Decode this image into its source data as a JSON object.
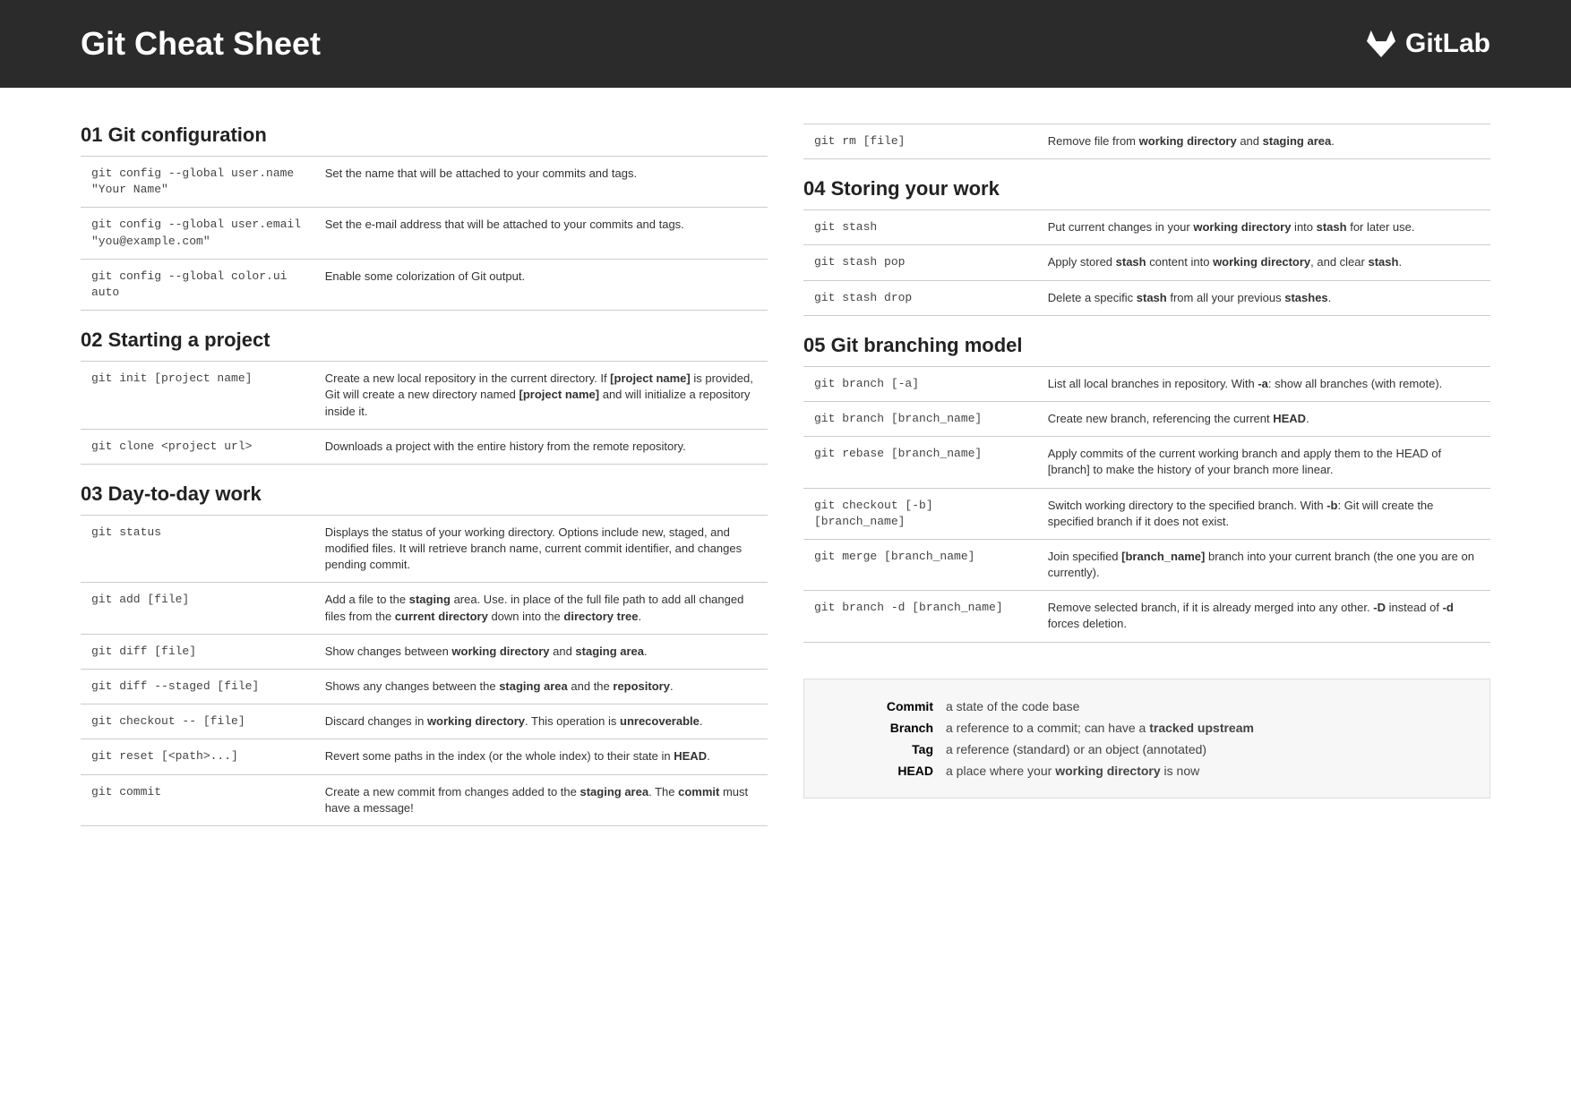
{
  "header": {
    "title": "Git Cheat Sheet",
    "brand": "GitLab"
  },
  "sections": {
    "s01": {
      "title": "01  Git configuration",
      "rows": [
        {
          "cmd": "git config --global user.name \"Your Name\"",
          "desc": "Set the name that will be attached to your commits and tags."
        },
        {
          "cmd": "git config --global user.email \"you@example.com\"",
          "desc": "Set the e-mail address that will be attached to your commits and tags."
        },
        {
          "cmd": "git config --global color.ui auto",
          "desc": "Enable some colorization of Git output."
        }
      ]
    },
    "s02": {
      "title": "02  Starting a project",
      "rows": [
        {
          "cmd": "git init [project name]",
          "desc": "Create a new local repository in the current directory. If <b>[project name]</b> is provided, Git will create a new directory named <b>[project name]</b> and will initialize a repository inside it."
        },
        {
          "cmd": "git clone <project url>",
          "desc": "Downloads a project with the entire history from the remote repository."
        }
      ]
    },
    "s03": {
      "title": "03  Day-to-day work",
      "rows": [
        {
          "cmd": "git status",
          "desc": "Displays the status of your working directory. Options include new, staged, and modified files. It will retrieve branch name, current commit identifier, and changes pending commit."
        },
        {
          "cmd": "git add [file]",
          "desc": "Add a file to the <b>staging</b> area. Use. in place of the full file path to add all changed files from the <b>current directory</b> down into the <b>directory tree</b>."
        },
        {
          "cmd": "git diff [file]",
          "desc": "Show changes between <b>working directory</b> and <b>staging area</b>."
        },
        {
          "cmd": "git diff --staged [file]",
          "desc": "Shows any changes between the <b>staging area</b> and the <b>repository</b>."
        },
        {
          "cmd": "git checkout -- [file]",
          "desc": "Discard changes in <b>working directory</b>. This operation is <b>unrecoverable</b>."
        },
        {
          "cmd": "git reset [<path>...]",
          "desc": "Revert some paths in the index (or the whole index) to their state in <b>HEAD</b>."
        },
        {
          "cmd": "git commit",
          "desc": "Create a new commit from changes added to the <b>staging area</b>. The <b>commit</b> must have a message!"
        }
      ]
    },
    "s03b": {
      "rows": [
        {
          "cmd": "git rm [file]",
          "desc": "Remove file from <b>working directory</b> and <b>staging area</b>."
        }
      ]
    },
    "s04": {
      "title": "04  Storing your work",
      "rows": [
        {
          "cmd": "git stash",
          "desc": "Put current changes in your <b>working directory</b> into <b>stash</b> for later use."
        },
        {
          "cmd": "git stash pop",
          "desc": "Apply stored <b>stash</b> content into <b>working directory</b>, and clear <b>stash</b>."
        },
        {
          "cmd": "git stash drop",
          "desc": "Delete a specific <b>stash</b> from all your previous <b>stashes</b>."
        }
      ]
    },
    "s05": {
      "title": "05  Git branching model",
      "rows": [
        {
          "cmd": "git branch [-a]",
          "desc": "List all local branches in repository. With <b>-a</b>: show all branches (with remote)."
        },
        {
          "cmd": "git branch [branch_name]",
          "desc": "Create new branch, referencing the current <b>HEAD</b>."
        },
        {
          "cmd": "git rebase [branch_name]",
          "desc": "Apply commits of the current working branch and apply them to the HEAD of [branch] to make the history of your branch more linear."
        },
        {
          "cmd": "git checkout [-b] [branch_name]",
          "desc": "Switch working directory to the specified branch. With <b>-b</b>: Git will create the specified branch if it does not exist."
        },
        {
          "cmd": "git merge [branch_name]",
          "desc": "Join specified <b>[branch_name]</b> branch into your current branch (the one you are on currently)."
        },
        {
          "cmd": "git branch -d [branch_name]",
          "desc": "Remove selected branch, if it is already merged into any other. <b>-D</b> instead of <b>-d</b> forces deletion."
        }
      ]
    }
  },
  "glossary": [
    {
      "term": "Commit",
      "def": "a state of the code base"
    },
    {
      "term": "Branch",
      "def": "a reference to a commit; can have a <b>tracked upstream</b>"
    },
    {
      "term": "Tag",
      "def": "a reference (standard) or an object (annotated)"
    },
    {
      "term": "HEAD",
      "def": "a place where your <b>working directory</b> is now"
    }
  ]
}
